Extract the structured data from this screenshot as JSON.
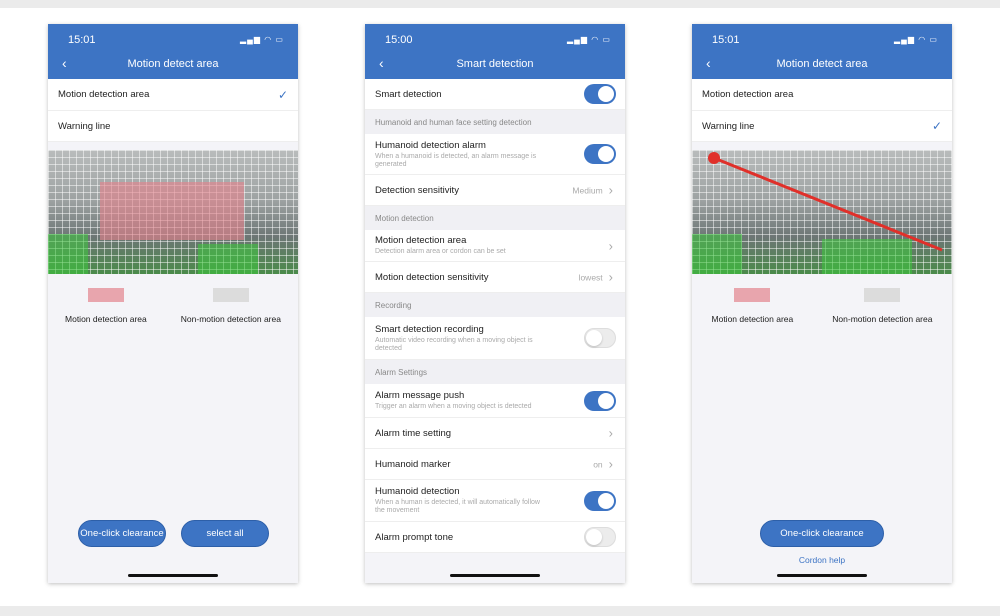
{
  "status_icons": "▂▄▆ ◠ ▭",
  "left": {
    "time": "15:01",
    "title": "Motion detect area",
    "options": [
      "Motion detection area",
      "Warning line"
    ],
    "selected": 0,
    "legend": [
      "Motion detection area",
      "Non-motion detection area"
    ],
    "buttons": [
      "One-click clearance",
      "select all"
    ]
  },
  "middle": {
    "time": "15:00",
    "title": "Smart detection",
    "smart_detection": "Smart detection",
    "sections": {
      "humanoid": "Humanoid and human face setting detection",
      "motion": "Motion detection",
      "recording": "Recording",
      "alarm": "Alarm Settings"
    },
    "items": [
      {
        "label": "Humanoid detection alarm",
        "sub": "When a humanoid is detected, an alarm message is generated",
        "toggle": true
      },
      {
        "label": "Detection sensitivity",
        "value": "Medium"
      },
      {
        "label": "Motion detection area",
        "sub": "Detection alarm area or cordon can be set"
      },
      {
        "label": "Motion detection sensitivity",
        "value": "lowest"
      },
      {
        "label": "Smart detection recording",
        "sub": "Automatic video recording when a moving object is detected",
        "toggle": false
      },
      {
        "label": "Alarm message push",
        "sub": "Trigger an alarm when a moving object is detected",
        "toggle": true
      },
      {
        "label": "Alarm time setting"
      },
      {
        "label": "Humanoid marker",
        "value": "on"
      },
      {
        "label": "Humanoid detection",
        "sub": "When a human is detected, it will automatically follow the movement",
        "toggle": true
      },
      {
        "label": "Alarm prompt tone",
        "toggle": false
      }
    ]
  },
  "right": {
    "time": "15:01",
    "title": "Motion detect area",
    "options": [
      "Motion detection area",
      "Warning line"
    ],
    "selected": 1,
    "legend": [
      "Motion detection area",
      "Non-motion detection area"
    ],
    "button": "One-click clearance",
    "help": "Cordon help"
  },
  "colors": {
    "accent": "#3d74c4",
    "motion_area": "#e8a5ad",
    "non_motion_area": "#dcdcdc"
  }
}
